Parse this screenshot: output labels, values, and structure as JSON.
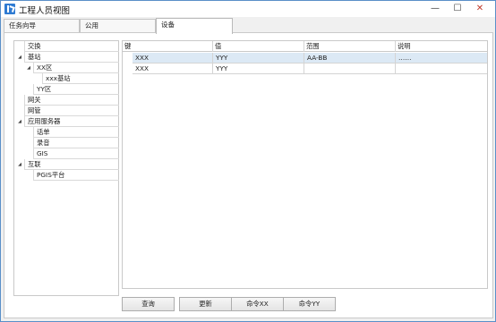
{
  "window": {
    "title": "工程人员视图",
    "controls": {
      "minimize": "—",
      "maximize": "☐",
      "close": "✕"
    }
  },
  "tabs": [
    {
      "label": "任务向导"
    },
    {
      "label": "公用"
    },
    {
      "label": "设备",
      "active": true
    }
  ],
  "tree": {
    "items": [
      {
        "label": "交换"
      },
      {
        "label": "基站",
        "expanded": true
      },
      {
        "label": "XX区",
        "expanded": true
      },
      {
        "label": "xxx基站"
      },
      {
        "label": "YY区"
      },
      {
        "label": "网关"
      },
      {
        "label": "网管"
      },
      {
        "label": "应用服务器",
        "expanded": true
      },
      {
        "label": "话单"
      },
      {
        "label": "录音"
      },
      {
        "label": "GIS"
      },
      {
        "label": "互联",
        "expanded": true
      },
      {
        "label": "PGIS平台"
      }
    ]
  },
  "grid": {
    "columns": [
      "键",
      "值",
      "范围",
      "说明"
    ],
    "rows": [
      {
        "key": "XXX",
        "value": "YYY",
        "range": "AA-BB",
        "note": "……",
        "selected": true
      },
      {
        "key": "XXX",
        "value": "YYY",
        "range": "",
        "note": ""
      }
    ]
  },
  "buttons": {
    "query": "查询",
    "update": "更新",
    "cmd_xx": "命令XX",
    "cmd_yy": "命令YY"
  }
}
